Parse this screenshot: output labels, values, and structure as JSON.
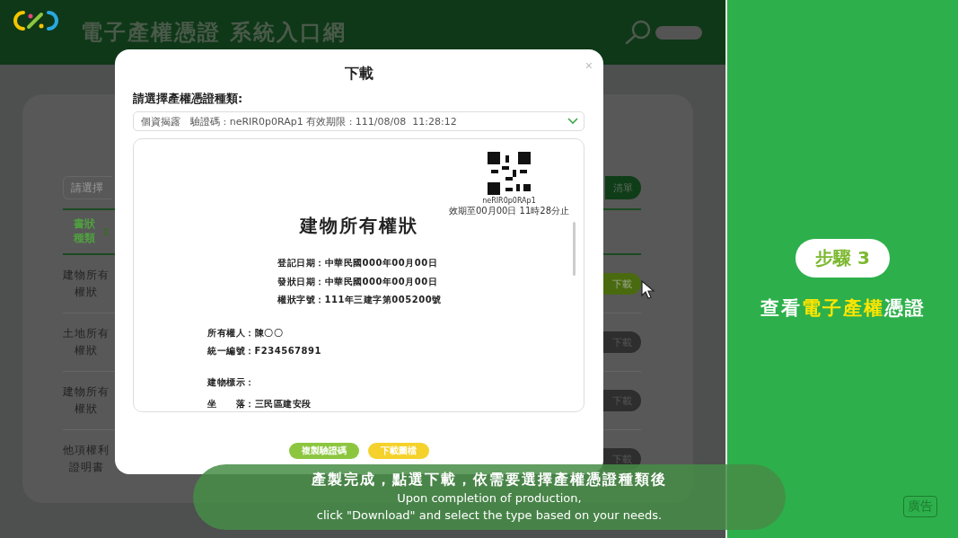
{
  "header": {
    "title": "電子產權憑證 系統入口網"
  },
  "background_page": {
    "search": {
      "placeholder": "請選擇"
    },
    "list_button": "清單",
    "table": {
      "column_1": "書狀種類",
      "rows": [
        {
          "type": "建物所有權狀",
          "action": "下載",
          "hovered": true
        },
        {
          "type": "土地所有權狀",
          "action": "下載",
          "hovered": false
        },
        {
          "type": "建物所有權狀",
          "action": "下載",
          "hovered": false
        },
        {
          "type": "他項權利證明書",
          "action": "下載",
          "hovered": false
        }
      ]
    }
  },
  "dialog": {
    "title": "下載",
    "close": "×",
    "select_label": "請選擇產權憑證種類:",
    "select_value": "個資揭露　驗證碼 : neRIR0p0RAp1 有效期限 : 111/08/08  11:28:12",
    "document": {
      "qr_code_text": "neRIR0p0RAp1",
      "qr_expiry": "效期至00月00日 11時28分止",
      "title": "建物所有權狀",
      "info_lines": [
        "登記日期：中華民國000年00月00日",
        "發狀日期：中華民國000年00月00日",
        "權狀字號：111年三建字第005200號"
      ],
      "owner_lines": [
        "所有權人：陳〇〇",
        "統一編號：F234567891"
      ],
      "section_lines": [
        "建物標示：",
        "坐　　落：三民區建安段"
      ]
    },
    "buttons": [
      {
        "label": "複製驗證碼",
        "kind": "copy"
      },
      {
        "label": "下載圖檔",
        "kind": "download"
      }
    ]
  },
  "caption": {
    "chinese": "產製完成，點選下載，依需要選擇產權憑證種類後",
    "english_lines": [
      "Upon completion of production,",
      "click \"Download\" and select the type based on your needs."
    ]
  },
  "step_panel": {
    "step": "步驟 3",
    "heading": [
      {
        "text": "查看",
        "highlight": false
      },
      {
        "text": "電子產權",
        "highlight": true
      },
      {
        "text": "憑證",
        "highlight": false
      }
    ]
  },
  "ad_badge": "廣告"
}
